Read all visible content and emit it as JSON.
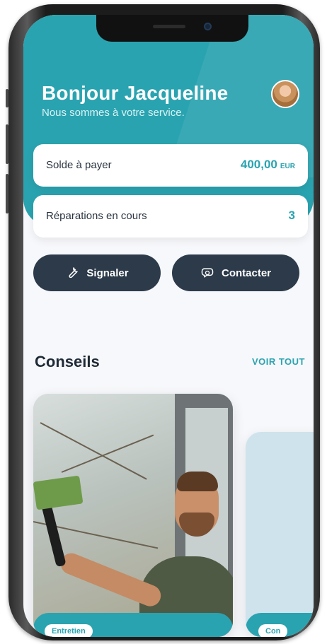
{
  "header": {
    "greeting": "Bonjour Jacqueline",
    "subtitle": "Nous sommes à votre service."
  },
  "balance_card": {
    "label": "Solde à payer",
    "amount": "400,00",
    "currency": "EUR"
  },
  "repairs_card": {
    "label": "Réparations en cours",
    "count": "3"
  },
  "actions": {
    "report_label": "Signaler",
    "contact_label": "Contacter"
  },
  "tips": {
    "title": "Conseils",
    "see_all_label": "VOIR TOUT",
    "cards": [
      {
        "tag": "Entretien"
      },
      {
        "tag": "Con"
      }
    ]
  },
  "colors": {
    "teal": "#2aa3b0",
    "navy": "#2c3a4a"
  },
  "icons": {
    "report": "wrench-icon",
    "contact": "chat-bubbles-icon"
  }
}
